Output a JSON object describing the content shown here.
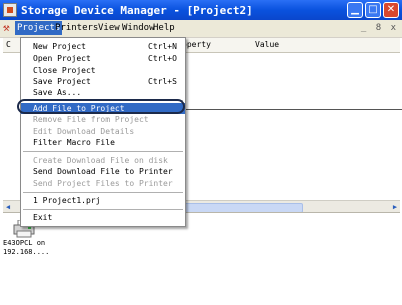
{
  "window": {
    "title": "Storage Device Manager - [Project2]"
  },
  "menubar": {
    "items": [
      "Projects",
      "Printers",
      "View",
      "Window",
      "Help"
    ],
    "mdi_controls": "_ 8 x"
  },
  "table": {
    "col1": "C",
    "property_header": "operty",
    "value_header": "Value"
  },
  "menu": {
    "items": [
      {
        "label": "New Project",
        "shortcut": "Ctrl+N"
      },
      {
        "label": "Open Project",
        "shortcut": "Ctrl+O"
      },
      {
        "label": "Close Project",
        "shortcut": ""
      },
      {
        "label": "Save Project",
        "shortcut": "Ctrl+S"
      },
      {
        "label": "Save As...",
        "shortcut": ""
      },
      {
        "label": "Add File to Project",
        "shortcut": ""
      },
      {
        "label": "Remove File from Project",
        "shortcut": ""
      },
      {
        "label": "Edit Download Details",
        "shortcut": ""
      },
      {
        "label": "Filter Macro File",
        "shortcut": ""
      },
      {
        "label": "Create Download File on disk",
        "shortcut": ""
      },
      {
        "label": "Send Download File to Printer",
        "shortcut": ""
      },
      {
        "label": "Send Project Files to Printer",
        "shortcut": ""
      },
      {
        "label": "1 Project1.prj",
        "shortcut": ""
      },
      {
        "label": "Exit",
        "shortcut": ""
      }
    ]
  },
  "printer": {
    "label_line1": "E43OPCL on",
    "label_line2": "192.168...."
  },
  "colors": {
    "title_blue": "#0a52de",
    "highlight": "#316ac5",
    "menubar_bg": "#ece9d8"
  },
  "icons": [
    "app-icon",
    "minimize-icon",
    "maximize-icon",
    "close-icon",
    "printer-icon",
    "scroll-left-icon",
    "scroll-right-icon"
  ]
}
